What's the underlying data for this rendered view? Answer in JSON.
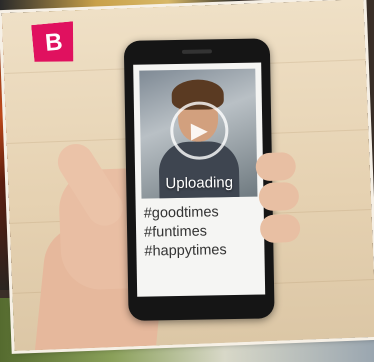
{
  "badge": {
    "letter": "B",
    "color": "#e0115f"
  },
  "video": {
    "status": "Uploading",
    "icon": "play-icon"
  },
  "hashtags": [
    "#goodtimes",
    "#funtimes",
    "#happytimes"
  ]
}
